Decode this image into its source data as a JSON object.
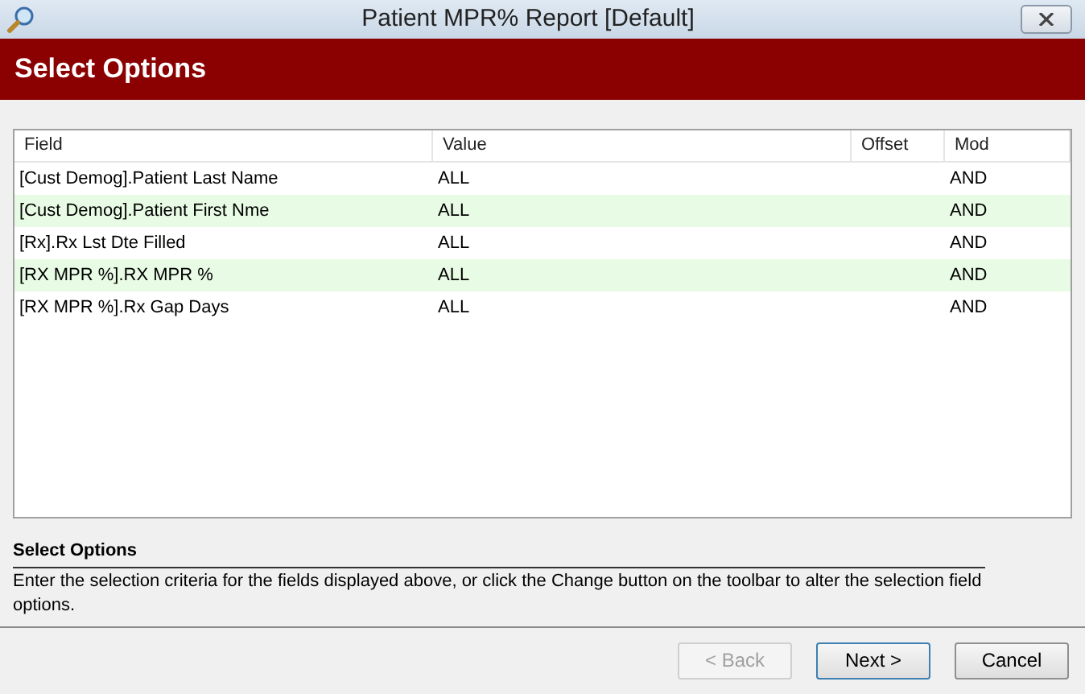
{
  "window": {
    "title": "Patient MPR% Report [Default]"
  },
  "header": {
    "title": "Select Options"
  },
  "table": {
    "columns": [
      "Field",
      "Value",
      "Offset",
      "Mod"
    ],
    "rows": [
      {
        "field": "[Cust Demog].Patient Last Name",
        "value": "ALL",
        "offset": "",
        "mod": "AND"
      },
      {
        "field": "[Cust Demog].Patient First Nme",
        "value": "ALL",
        "offset": "",
        "mod": "AND"
      },
      {
        "field": "[Rx].Rx Lst Dte Filled",
        "value": "ALL",
        "offset": "",
        "mod": "AND"
      },
      {
        "field": "[RX MPR %].RX MPR %",
        "value": "ALL",
        "offset": "",
        "mod": "AND"
      },
      {
        "field": "[RX MPR %].Rx Gap Days",
        "value": "ALL",
        "offset": "",
        "mod": "AND"
      }
    ]
  },
  "help": {
    "title": "Select Options",
    "text": "Enter the selection criteria for the fields displayed above, or click the Change button on the toolbar to alter the selection field options."
  },
  "buttons": [
    {
      "label": "< Back",
      "disabled": true,
      "default": false
    },
    {
      "label": "Next >",
      "disabled": false,
      "default": true
    },
    {
      "label": "Cancel",
      "disabled": false,
      "default": false
    }
  ]
}
